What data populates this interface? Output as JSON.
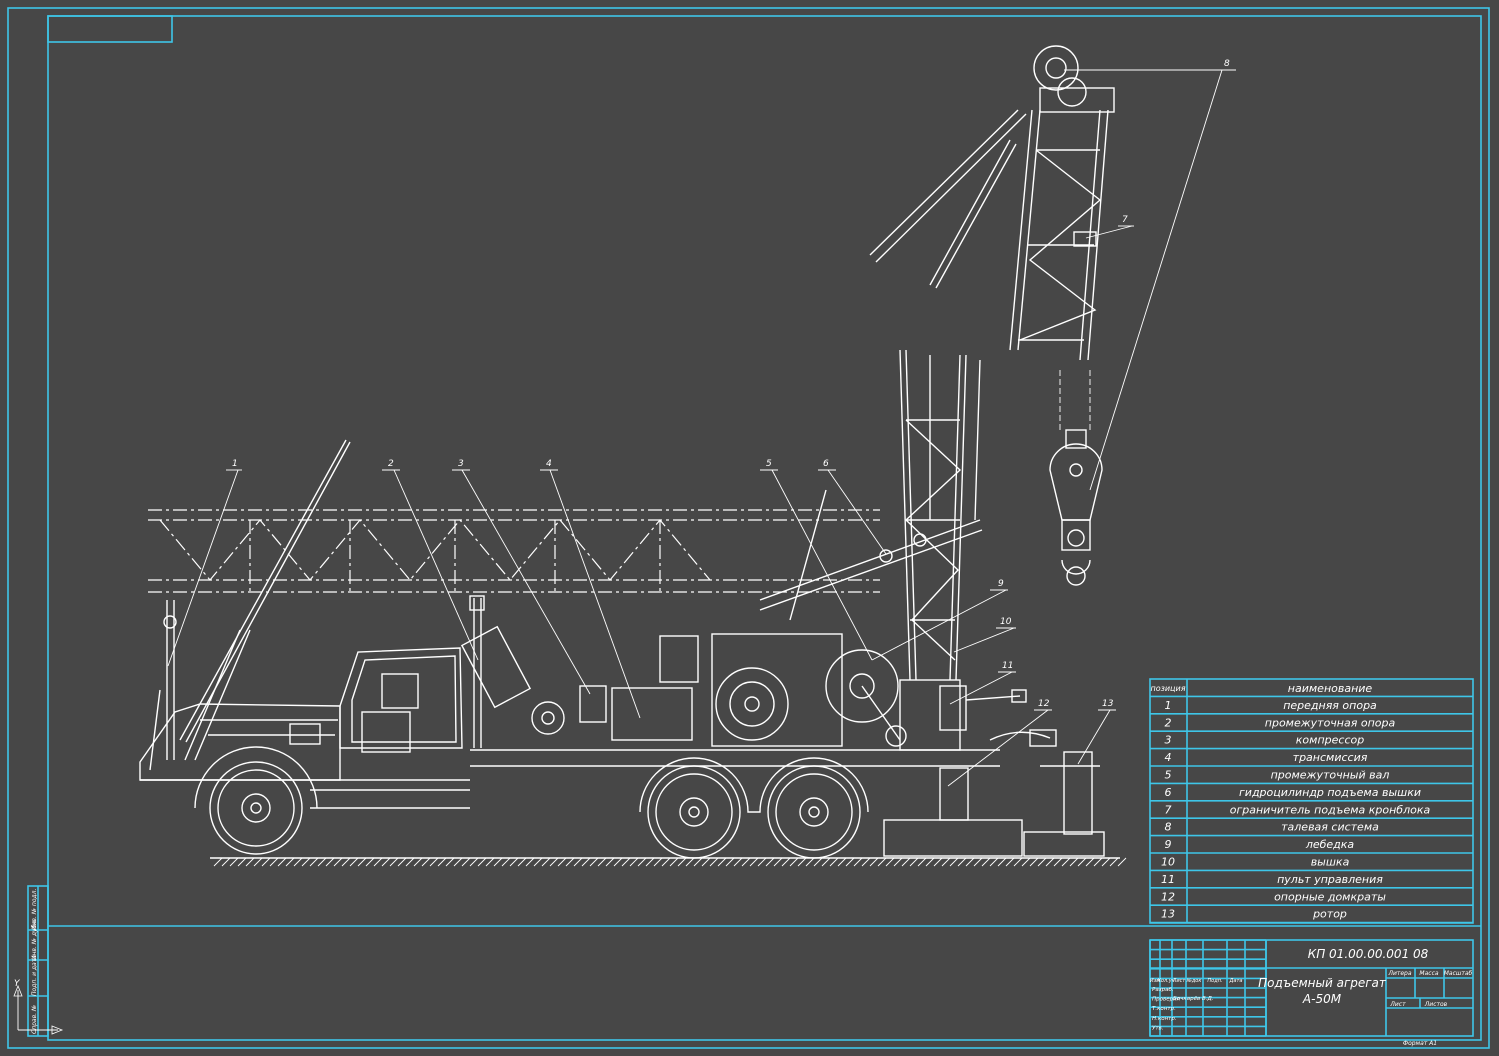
{
  "drawing": {
    "code": "КП 01.00.00.001 08",
    "title_line1": "Подъемный агрегат",
    "title_line2": "А-50М",
    "format": "Формат  А1"
  },
  "table": {
    "header_pos": "позиция",
    "header_name": "наименование",
    "rows": [
      {
        "pos": "1",
        "name": "передняя опора"
      },
      {
        "pos": "2",
        "name": "промежуточная опора"
      },
      {
        "pos": "3",
        "name": "компрессор"
      },
      {
        "pos": "4",
        "name": "трансмиссия"
      },
      {
        "pos": "5",
        "name": "промежуточный вал"
      },
      {
        "pos": "6",
        "name": "гидроцилиндр подъема вышки"
      },
      {
        "pos": "7",
        "name": "ограничитель подъема кронблока"
      },
      {
        "pos": "8",
        "name": "талевая система"
      },
      {
        "pos": "9",
        "name": "лебедка"
      },
      {
        "pos": "10",
        "name": "вышка"
      },
      {
        "pos": "11",
        "name": "пульт управления"
      },
      {
        "pos": "12",
        "name": "опорные домкраты"
      },
      {
        "pos": "13",
        "name": "ротор"
      }
    ]
  },
  "stamp": {
    "cols": [
      "Изм",
      "Кол.уч",
      "Лист",
      "№док",
      "Подп.",
      "Дата"
    ],
    "roles": [
      "Разраб.",
      "Проверил",
      "Т.контр.",
      "Н.контр.",
      "Утв."
    ],
    "checker_name": "Бочкарёв В.Д.",
    "litera": "Литера",
    "mass": "Масса",
    "scale": "Масштаб",
    "sheet": "Лист",
    "sheets": "Листов"
  },
  "side_labels": [
    "Перв. прим.",
    "Справ. №",
    "Подп. и дата",
    "Инв. № дубл.",
    "Инв. № подл."
  ],
  "leaders": [
    "1",
    "2",
    "3",
    "4",
    "5",
    "6",
    "7",
    "8",
    "9",
    "10",
    "11",
    "12",
    "13"
  ]
}
